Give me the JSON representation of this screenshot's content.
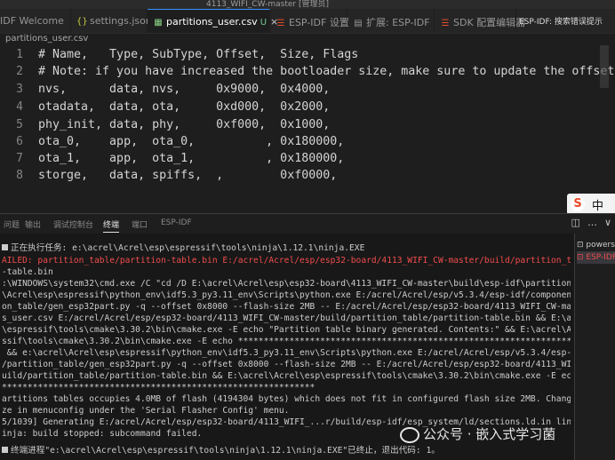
{
  "window": {
    "title": "4113_WIFI_CW-master [管理员]"
  },
  "tabs": [
    {
      "label": "IDF Welcome",
      "icon": "idf-icon"
    },
    {
      "label": "settings.json",
      "icon": "braces-icon"
    },
    {
      "label": "partitions_user.csv",
      "icon": "table-icon",
      "modified": "U",
      "close": "×"
    },
    {
      "label": "ESP-IDF 设置",
      "icon": "esp-icon"
    },
    {
      "label": "扩展: ESP-IDF",
      "icon": "extensions-icon"
    },
    {
      "label": "SDK 配置编辑器",
      "icon": "esp-icon"
    },
    {
      "label": "ESP-IDF: 搜索错误提示",
      "icon": ""
    }
  ],
  "breadcrumb": "partitions_user.csv",
  "editor": {
    "lines": [
      {
        "num": "1",
        "text": "# Name,   Type, SubType, Offset,  Size, Flags"
      },
      {
        "num": "2",
        "text": "# Note: if you have increased the bootloader size, make sure to update the offset"
      },
      {
        "num": "3",
        "text": "nvs,      data, nvs,     0x9000,  0x4000,"
      },
      {
        "num": "4",
        "text": "otadata,  data, ota,     0xd000,  0x2000,"
      },
      {
        "num": "5",
        "text": "phy_init, data, phy,     0xf000,  0x1000,"
      },
      {
        "num": "6",
        "text": "ota_0,    app,  ota_0,          , 0x180000,"
      },
      {
        "num": "7",
        "text": "ota_1,    app,  ota_1,          , 0x180000,"
      },
      {
        "num": "8",
        "text": "storge,   data, spiffs,  ,        0xf0000,"
      }
    ]
  },
  "ime": {
    "logo": "S",
    "lang": "中"
  },
  "panel": {
    "tabs": [
      "问题",
      "输出",
      "调试控制台",
      "终端",
      "端口",
      "ESP-IDF"
    ],
    "active_tab": "终端",
    "actions": {
      "split": "◫",
      "more": "…",
      "close": "∨"
    }
  },
  "terminal": {
    "lines": [
      {
        "text": "正在执行任务: e:\\acrel\\Acrel\\esp\\espressif\\tools\\ninja\\1.12.1\\ninja.EXE",
        "marker": true,
        "style": "normal"
      },
      {
        "text": "AILED: partition_table/partition-table.bin E:/acrel/Acrel/esp/esp32-board/4113_WIFI_CW-master/build/partition_table/partitio",
        "marker": false,
        "style": "err"
      },
      {
        "text": "-table.bin",
        "marker": false,
        "style": "normal"
      },
      {
        "text": ":\\WINDOWS\\system32\\cmd.exe /C \"cd /D E:\\acrel\\Acrel\\esp\\esp32-board\\4113_WIFI_CW-master\\build\\esp-idf\\partition_table && e:\\",
        "marker": false,
        "style": "normal"
      },
      {
        "text": "\\Acrel\\esp\\espressif\\python_env\\idf5.3_py3.11_env\\Scripts\\python.exe E:/acrel/Acrel/esp/v5.3.4/esp-idf/components/partit",
        "marker": false,
        "style": "normal"
      },
      {
        "text": "on_table/gen_esp32part.py -q --offset 0x8000 --flash-size 2MB -- E:/acrel/Acrel/esp/esp32-board/4113_WIFI_CW-master/partitio",
        "marker": false,
        "style": "normal"
      },
      {
        "text": "s_user.csv E:/acrel/Acrel/esp/esp32-board/4113_WIFI_CW-master/build/partition_table/partition-table.bin && E:\\acrel\\Acrel\\es",
        "marker": false,
        "style": "normal"
      },
      {
        "text": "\\espressif\\tools\\cmake\\3.30.2\\bin\\cmake.exe -E echo \"Partition table binary generated. Contents:\" && E:\\acrel\\Acrel\\esp\\espr",
        "marker": false,
        "style": "normal"
      },
      {
        "text": "ssif\\tools\\cmake\\3.30.2\\bin\\cmake.exe -E echo *********************************************************************",
        "marker": false,
        "style": "normal"
      },
      {
        "text": " && e:\\acrel\\Acrel\\esp\\espressif\\python_env\\idf5.3_py3.11_env\\Scripts\\python.exe E:/acrel/Acrel/esp/v5.3.4/esp-idf/component",
        "marker": false,
        "style": "normal"
      },
      {
        "text": "/partition_table/gen_esp32part.py -q --offset 0x8000 --flash-size 2MB -- E:/acrel/Acrel/esp/esp32-board/4113_WIFI_CW-master/",
        "marker": false,
        "style": "normal"
      },
      {
        "text": "uild/partition_table/partition-table.bin && E:\\acrel\\Acrel\\esp\\espressif\\tools\\cmake\\3.30.2\\bin\\cmake.exe -E echo *********",
        "marker": false,
        "style": "normal"
      },
      {
        "text": "*************************************************************",
        "marker": false,
        "style": "normal"
      },
      {
        "text": "artitions tables occupies 4.0MB of flash (4194304 bytes) which does not fit in configured flash size 2MB. Change the flash si",
        "marker": false,
        "style": "normal"
      },
      {
        "text": "ze in menuconfig under the 'Serial Flasher Config' menu.",
        "marker": false,
        "style": "normal"
      },
      {
        "text": "5/1039] Generating E:/acrel/Acrel/esp/esp32-board/4113_WIFI_...r/build/esp-idf/esp_system/ld/sections.ld.in linker script..",
        "marker": false,
        "style": "normal"
      },
      {
        "text": "inja: build stopped: subcommand failed.",
        "marker": false,
        "style": "normal"
      },
      {
        "text": "",
        "marker": false,
        "style": "normal"
      },
      {
        "text": "终端进程\"e:\\acrel\\Acrel\\esp\\espressif\\tools\\ninja\\1.12.1\\ninja.EXE\"已终止，退出代码: 1。",
        "marker": true,
        "style": "normal"
      }
    ]
  },
  "terminal_list": [
    {
      "label": "powershell",
      "icon": "terminal-icon",
      "selected": false
    },
    {
      "label": "ESP-IDF",
      "icon": "terminal-icon",
      "selected": true
    }
  ],
  "watermark": "公众号 · 嵌入式学习菌"
}
